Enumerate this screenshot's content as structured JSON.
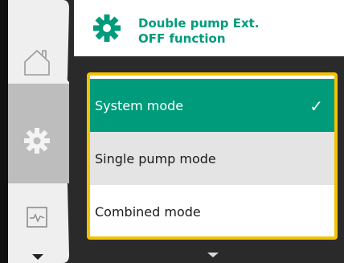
{
  "header": {
    "title": "Double pump Ext.\nOFF function",
    "icon": "gear-icon"
  },
  "rail": {
    "items": [
      {
        "name": "home",
        "icon": "home-icon"
      },
      {
        "name": "settings",
        "icon": "gear-icon",
        "active": true
      },
      {
        "name": "monitor",
        "icon": "pulse-monitor-icon"
      }
    ]
  },
  "options": [
    {
      "label": "System mode",
      "selected": true
    },
    {
      "label": "Single pump mode",
      "selected": false
    },
    {
      "label": "Combined mode",
      "selected": false
    }
  ],
  "colors": {
    "accent": "#009b7b",
    "focus": "#f3c300",
    "row_grey": "#e4e4e4"
  }
}
